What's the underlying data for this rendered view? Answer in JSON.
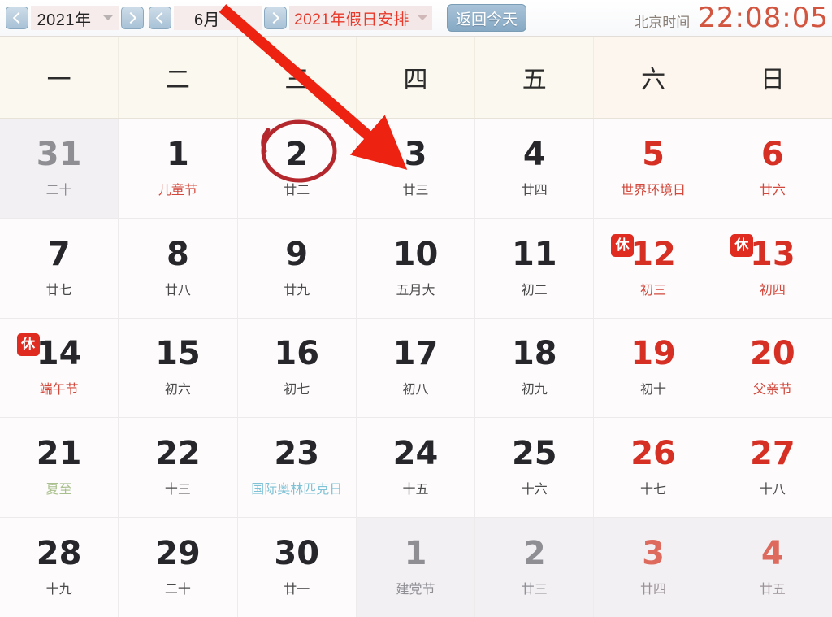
{
  "toolbar": {
    "prev_year_icon": "chevron-left-icon",
    "next_year_icon": "chevron-right-icon",
    "prev_month_icon": "chevron-left-icon",
    "next_month_icon": "chevron-right-icon",
    "year_value": "2021年",
    "month_value": "6月",
    "holiday_menu_label": "2021年假日安排",
    "today_button_label": "返回今天",
    "clock_label": "北京时间",
    "clock_time": "22:08:05",
    "accent_red": "#e8392a",
    "clock_color": "#d2553f",
    "button_blue": "#86a9c4"
  },
  "weekdays": [
    "一",
    "二",
    "三",
    "四",
    "五",
    "六",
    "日"
  ],
  "calendar": {
    "rest_badge_label": "休",
    "weeks": [
      [
        {
          "day": "31",
          "sub": "二十",
          "out": true
        },
        {
          "day": "1",
          "sub": "儿童节",
          "sub_style": "festival"
        },
        {
          "day": "2",
          "sub": "廿二",
          "circled": true
        },
        {
          "day": "3",
          "sub": "廿三"
        },
        {
          "day": "4",
          "sub": "廿四"
        },
        {
          "day": "5",
          "sub": "世界环境日",
          "sub_style": "solar",
          "red": true
        },
        {
          "day": "6",
          "sub": "廿六",
          "red": true
        }
      ],
      [
        {
          "day": "7",
          "sub": "廿七"
        },
        {
          "day": "8",
          "sub": "廿八"
        },
        {
          "day": "9",
          "sub": "廿九"
        },
        {
          "day": "10",
          "sub": "五月大"
        },
        {
          "day": "11",
          "sub": "初二"
        },
        {
          "day": "12",
          "sub": "初三",
          "red": true,
          "rest": true
        },
        {
          "day": "13",
          "sub": "初四",
          "red": true,
          "rest": true
        }
      ],
      [
        {
          "day": "14",
          "sub": "端午节",
          "sub_style": "festival",
          "rest": true
        },
        {
          "day": "15",
          "sub": "初六"
        },
        {
          "day": "16",
          "sub": "初七"
        },
        {
          "day": "17",
          "sub": "初八"
        },
        {
          "day": "18",
          "sub": "初九"
        },
        {
          "day": "19",
          "sub": "初十",
          "red": true,
          "sub_dark": true
        },
        {
          "day": "20",
          "sub": "父亲节",
          "red": true,
          "sub_style": "festival"
        }
      ],
      [
        {
          "day": "21",
          "sub": "夏至",
          "sub_style": "solar"
        },
        {
          "day": "22",
          "sub": "十三"
        },
        {
          "day": "23",
          "sub": "国际奥林匹克日",
          "sub_style": "intl"
        },
        {
          "day": "24",
          "sub": "十五"
        },
        {
          "day": "25",
          "sub": "十六"
        },
        {
          "day": "26",
          "sub": "十七",
          "red": true,
          "sub_dark": true
        },
        {
          "day": "27",
          "sub": "十八",
          "red": true,
          "sub_dark": true
        }
      ],
      [
        {
          "day": "28",
          "sub": "十九"
        },
        {
          "day": "29",
          "sub": "二十"
        },
        {
          "day": "30",
          "sub": "廿一"
        },
        {
          "day": "1",
          "sub": "建党节",
          "out": true,
          "sub_style": "fadefest"
        },
        {
          "day": "2",
          "sub": "廿三",
          "out": true
        },
        {
          "day": "3",
          "sub": "廿四",
          "out": true,
          "red": true
        },
        {
          "day": "4",
          "sub": "廿五",
          "out": true,
          "red": true
        }
      ]
    ]
  },
  "annotations": {
    "arrow_color": "#ee2211",
    "circle_color": "#b4282d",
    "arrow_name": "red-pointer-arrow",
    "circle_name": "red-highlight-circle"
  }
}
